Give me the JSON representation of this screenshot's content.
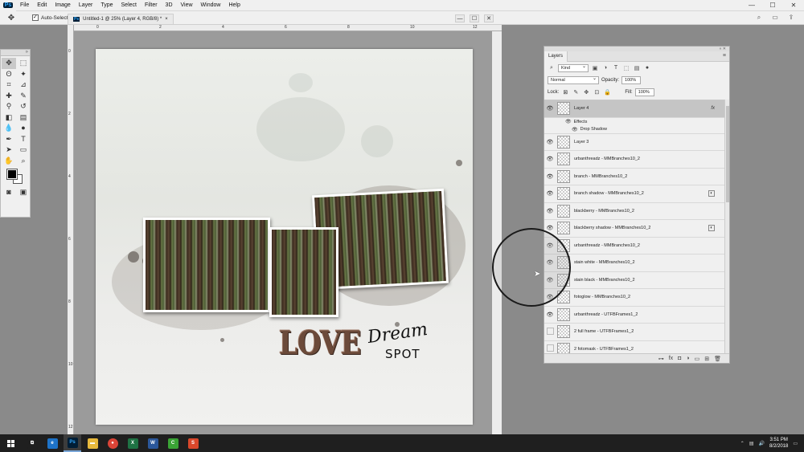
{
  "app": {
    "logo": "Ps"
  },
  "menu": [
    "File",
    "Edit",
    "Image",
    "Layer",
    "Type",
    "Select",
    "Filter",
    "3D",
    "View",
    "Window",
    "Help"
  ],
  "window_controls": [
    "—",
    "☐",
    "✕"
  ],
  "options_bar": {
    "auto_select_label": "Auto-Select:"
  },
  "document": {
    "tab_title": "Untitled-1 @ 25% (Layer 4, RGB/8) *",
    "tab_close": "×",
    "ruler_h": [
      "0",
      "2",
      "4",
      "6",
      "8",
      "10",
      "12"
    ],
    "ruler_v": [
      "0",
      "2",
      "4",
      "6",
      "8",
      "10",
      "12"
    ]
  },
  "canvas": {
    "title_love": "LOVE",
    "title_dream": "Dream",
    "title_spot": "SPOT"
  },
  "layers_panel": {
    "tab": "Layers",
    "kind_label": "Kind",
    "blend_mode": "Normal",
    "opacity_label": "Opacity:",
    "opacity_value": "100%",
    "lock_label": "Lock:",
    "fill_label": "Fill:",
    "fill_value": "100%",
    "effects_label": "Effects",
    "drop_shadow_label": "Drop Shadow",
    "fx_badge": "fx",
    "layers": [
      {
        "name": "Layer 4",
        "visible": true,
        "selected": true,
        "fx": true
      },
      {
        "name": "Layer 3",
        "visible": true
      },
      {
        "name": "urbanthreadz - MMBranches10_2",
        "visible": true
      },
      {
        "name": "branch - MMBranches10_2",
        "visible": true
      },
      {
        "name": "branch shadow - MMBranches10_2",
        "visible": true,
        "linked": true
      },
      {
        "name": "blackberry - MMBranches10_2",
        "visible": true
      },
      {
        "name": "blackberry shadow - MMBranches10_2",
        "visible": true,
        "linked": true
      },
      {
        "name": "urbanthreadz - MMBranches10_2",
        "visible": true
      },
      {
        "name": "stain white - MMBranches10_2",
        "visible": true
      },
      {
        "name": "stain black - MMBranches10_2",
        "visible": true
      },
      {
        "name": "fotoglow - MMBranches10_2",
        "visible": true
      },
      {
        "name": "urbanthreadz - UTFBFrames1_2",
        "visible": true
      },
      {
        "name": "2 full frame - UTFBFrames1_2",
        "visible": false
      },
      {
        "name": "2 fotomask - UTFBFrames1_2",
        "visible": false
      }
    ]
  },
  "taskbar": {
    "clock_time": "3:51 PM",
    "clock_date": "8/2/2018",
    "apps": [
      {
        "name": "task-view",
        "label": "⧉",
        "color": "#1f1f1f"
      },
      {
        "name": "edge",
        "label": "e",
        "color": "#1e73c8"
      },
      {
        "name": "photoshop",
        "label": "Ps",
        "color": "#001e36",
        "active": true
      },
      {
        "name": "file-explorer",
        "label": "▬",
        "color": "#e8b93c"
      },
      {
        "name": "chrome",
        "label": "●",
        "color": "#db4437"
      },
      {
        "name": "excel",
        "label": "X",
        "color": "#1f7244"
      },
      {
        "name": "word",
        "label": "W",
        "color": "#2b579a"
      },
      {
        "name": "camtasia",
        "label": "C",
        "color": "#3aa335"
      },
      {
        "name": "snagit",
        "label": "S",
        "color": "#d9472b"
      }
    ]
  }
}
